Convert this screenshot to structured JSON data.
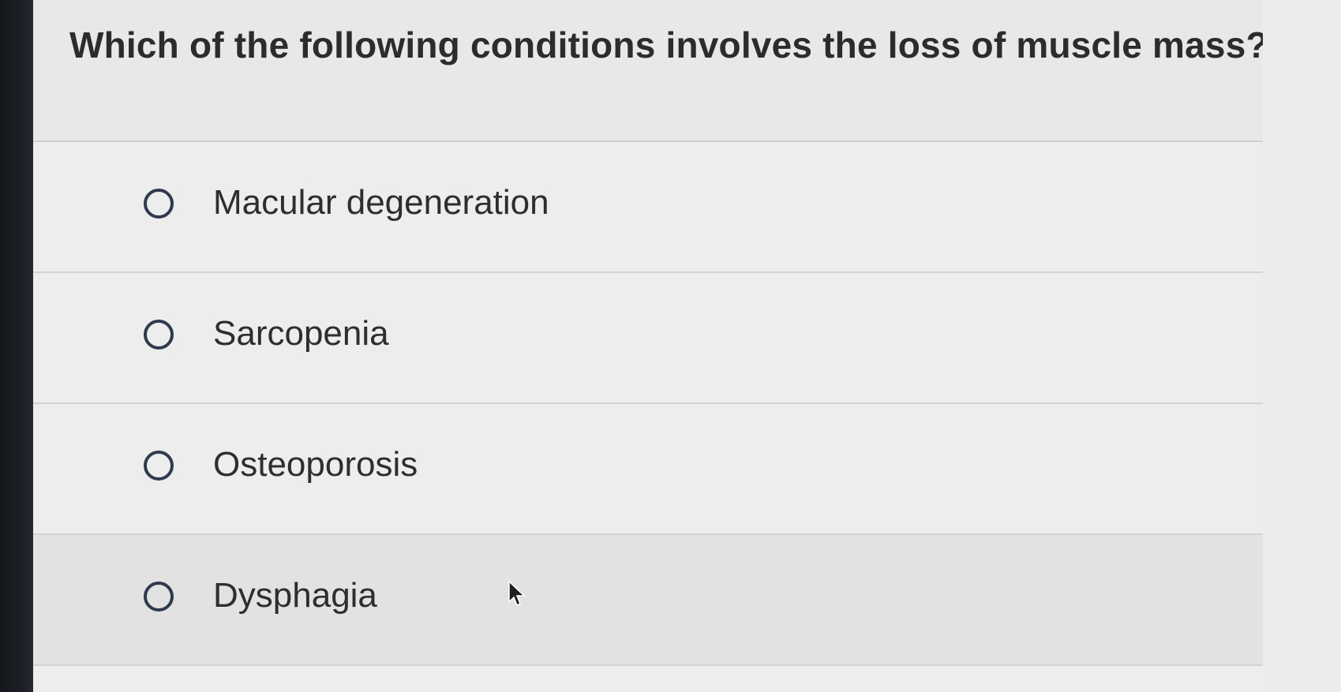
{
  "question": {
    "text": "Which of the following conditions involves the loss of muscle mass?"
  },
  "choices": [
    {
      "label": "Macular degeneration"
    },
    {
      "label": "Sarcopenia"
    },
    {
      "label": "Osteoporosis"
    },
    {
      "label": "Dysphagia"
    }
  ],
  "colors": {
    "radio_border": "#2f3b4d",
    "text": "#2e2e2e",
    "background": "#ededed",
    "bezel": "#1d2026"
  },
  "icons": {
    "radio": "radio-unselected-icon",
    "cursor": "mouse-pointer-icon"
  }
}
